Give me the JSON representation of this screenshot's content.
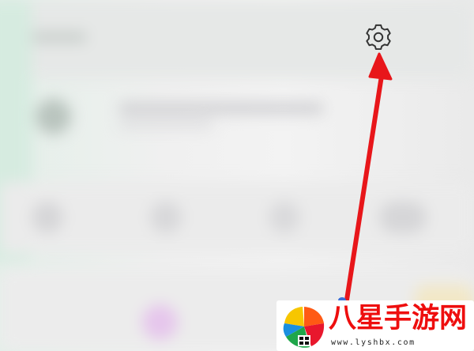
{
  "toolbar": {
    "settings_icon": "gear-icon"
  },
  "annotation": {
    "type": "arrow",
    "color": "#e8161a",
    "points_to": "settings-gear-button"
  },
  "watermark": {
    "title": "八星手游网",
    "url": "www.lyshbx.com",
    "title_color": "#ee0e0e",
    "logo_icon": "pinwheel-logo"
  },
  "colors": {
    "background": "#efefef",
    "gear_stroke": "#333333"
  }
}
